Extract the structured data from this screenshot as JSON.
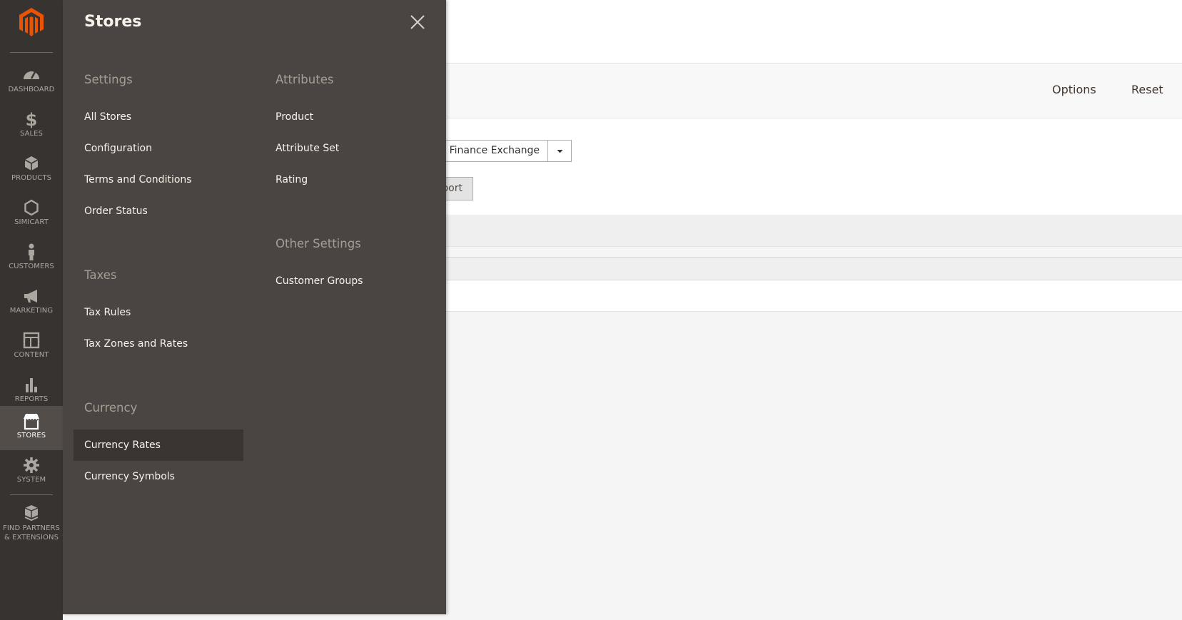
{
  "nav": {
    "items": [
      {
        "label": "DASHBOARD"
      },
      {
        "label": "SALES"
      },
      {
        "label": "PRODUCTS"
      },
      {
        "label": "SIMICART"
      },
      {
        "label": "CUSTOMERS"
      },
      {
        "label": "MARKETING"
      },
      {
        "label": "CONTENT"
      },
      {
        "label": "REPORTS"
      },
      {
        "label": "STORES"
      },
      {
        "label": "SYSTEM"
      },
      {
        "label_line1": "FIND PARTNERS",
        "label_line2": "& EXTENSIONS"
      }
    ],
    "active": "STORES",
    "accent": "#eb5202"
  },
  "toolbar": {
    "options_label": "Options",
    "reset_label": "Reset"
  },
  "content": {
    "service_select_value": "oo Finance Exchange",
    "import_label": "port"
  },
  "flyout": {
    "title": "Stores",
    "settings": {
      "heading": "Settings",
      "items": [
        "All Stores",
        "Configuration",
        "Terms and Conditions",
        "Order Status"
      ]
    },
    "taxes": {
      "heading": "Taxes",
      "items": [
        "Tax Rules",
        "Tax Zones and Rates"
      ]
    },
    "currency": {
      "heading": "Currency",
      "items": [
        "Currency Rates",
        "Currency Symbols"
      ],
      "active": "Currency Rates"
    },
    "attributes": {
      "heading": "Attributes",
      "items": [
        "Product",
        "Attribute Set",
        "Rating"
      ]
    },
    "other_settings": {
      "heading": "Other Settings",
      "items": [
        "Customer Groups"
      ]
    }
  }
}
